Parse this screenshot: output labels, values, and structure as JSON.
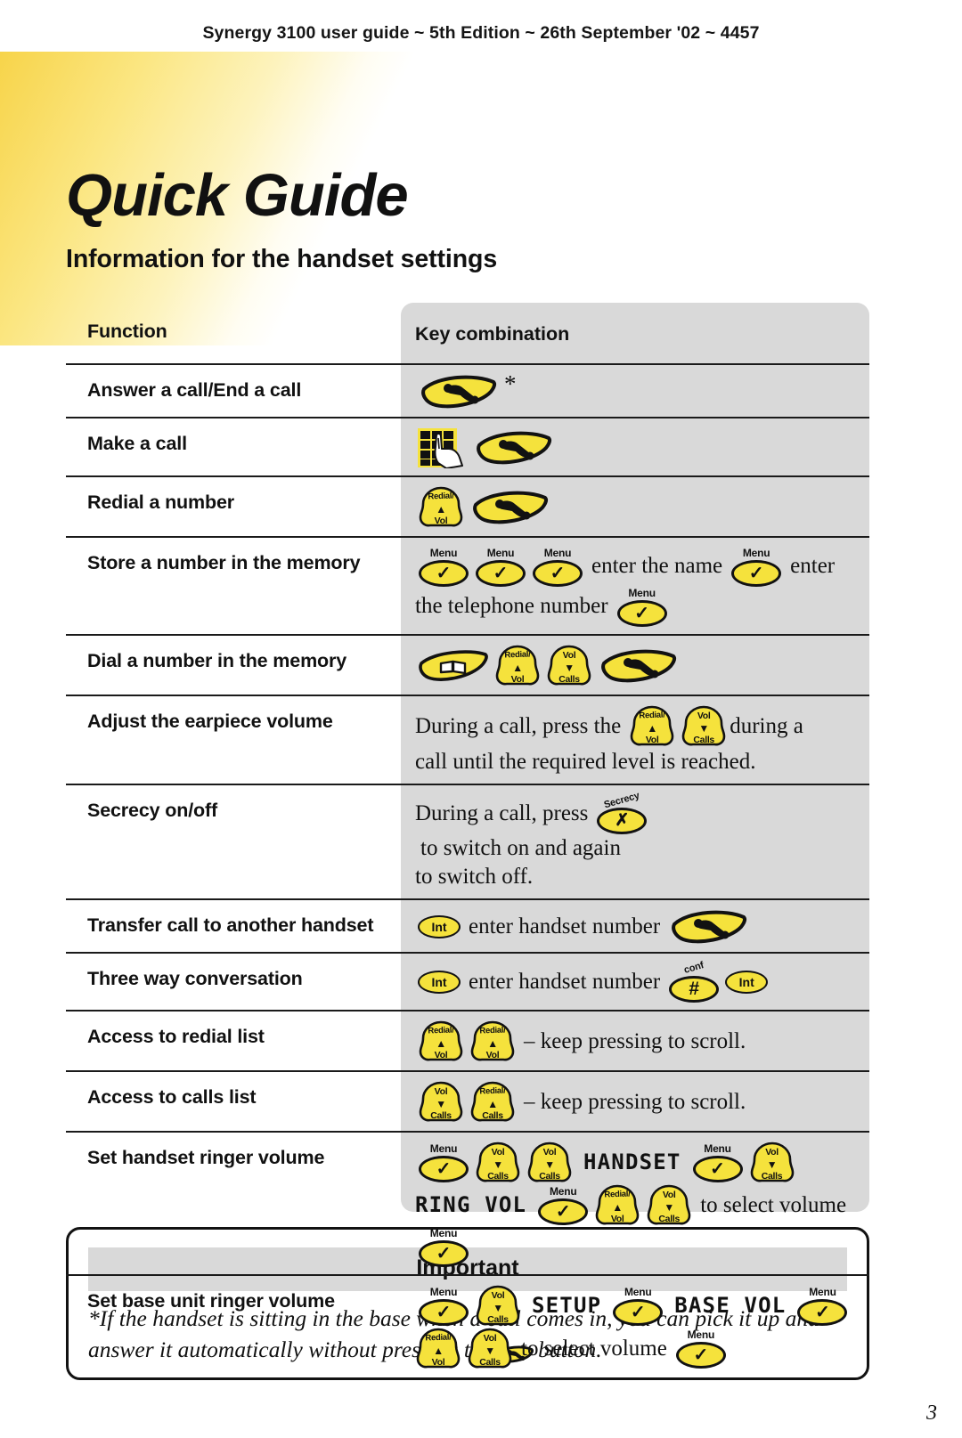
{
  "header": {
    "running_head": "Synergy 3100 user guide ~ 5th Edition ~ 26th September '02 ~ 4457"
  },
  "title": {
    "main": "Quick Guide",
    "subtitle": "Information for the handset settings"
  },
  "table": {
    "columns": {
      "function": "Function",
      "key_combination": "Key combination"
    },
    "rows": [
      {
        "function": "Answer a call/End a call",
        "keys": [
          "talk-key",
          "asterisk"
        ]
      },
      {
        "function": "Make a call",
        "keys": [
          "keypad-icon",
          "talk-key"
        ]
      },
      {
        "function": "Redial a number",
        "keys": [
          "redial-vol-key",
          "talk-key"
        ]
      },
      {
        "function": "Store a number in the memory",
        "keys": [
          "menu-key",
          "menu-key",
          "menu-key",
          "enter the name",
          "menu-key",
          "enter the telephone number",
          "menu-key"
        ],
        "text1": "enter the name",
        "text2": "enter",
        "text3": "the telephone number"
      },
      {
        "function": "Dial a number in the memory",
        "keys": [
          "phonebook-key",
          "redial-vol-key",
          "vol-calls-key",
          "talk-key"
        ]
      },
      {
        "function": "Adjust the earpiece volume",
        "text1": "During a call, press the",
        "text2": "during a",
        "text3": "call until the required level is reached."
      },
      {
        "function": "Secrecy on/off",
        "text1": "During a call, press",
        "text2": "to switch on and again",
        "text3": "to switch off."
      },
      {
        "function": "Transfer call to another handset",
        "text1": "enter handset number"
      },
      {
        "function": "Three way conversation",
        "text1": "enter handset number"
      },
      {
        "function": "Access to redial list",
        "text1": "–  keep pressing to scroll."
      },
      {
        "function": "Access to calls list",
        "text1": "–  keep pressing to scroll."
      },
      {
        "function": "Set handset ringer volume",
        "lcd1": "HANDSET",
        "lcd2": "RING VOL",
        "text1": "to select volume"
      },
      {
        "function": "Set base unit ringer volume",
        "lcd1": "SETUP",
        "lcd2": "BASE VOL",
        "text1": "to select volume"
      }
    ]
  },
  "key_labels": {
    "menu": "Menu",
    "secrecy": "Secrecy",
    "conf": "conf",
    "int": "Int",
    "redial": "Redial/",
    "vol": "Vol",
    "calls": "Calls",
    "check": "✓",
    "cross": "✗",
    "hash": "#",
    "up_arrow": "▲",
    "down_arrow": "▼",
    "asterisk": "*"
  },
  "important": {
    "heading": "Important",
    "body_part1": "*If the handset is sitting in the base when a call comes in, you can pick it up and answer it automatically without pressing the",
    "body_part2": "button."
  },
  "footer": {
    "page_number": "3"
  },
  "colors": {
    "key_yellow": "#f5e23c",
    "panel_grey": "#d9d9d9",
    "ink": "#111111"
  }
}
